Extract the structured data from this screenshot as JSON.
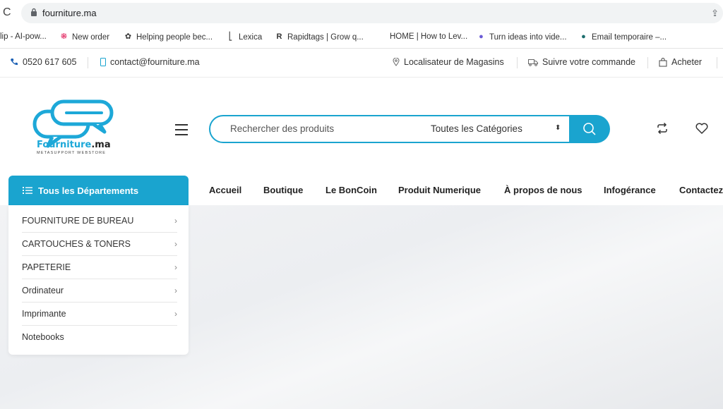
{
  "browser": {
    "url": "fourniture.ma",
    "bookmarks": [
      {
        "label": "lip - AI-pow...",
        "icon": ""
      },
      {
        "label": "New order",
        "icon": "slack-icon"
      },
      {
        "label": "Helping people bec...",
        "icon": "openai-icon"
      },
      {
        "label": "Lexica",
        "icon": "lexica-icon"
      },
      {
        "label": "Rapidtags | Grow q...",
        "icon": "rapidtags-icon"
      },
      {
        "label": "HOME | How to Lev...",
        "icon": ""
      },
      {
        "label": "Turn ideas into vide...",
        "icon": "video-icon"
      },
      {
        "label": "Email temporaire –...",
        "icon": "email-icon"
      }
    ]
  },
  "topbar": {
    "phone": "0520 617 605",
    "email": "contact@fourniture.ma",
    "store_locator": "Localisateur de Magasins",
    "track_order": "Suivre votre commande",
    "shop": "Acheter"
  },
  "header": {
    "logo_brand": "Fourniture",
    "logo_tld": ".ma",
    "logo_tagline": "METASUPPORT WEBSTORE",
    "search_placeholder": "Rechercher des produits",
    "category_selected": "Toutes les Catégories"
  },
  "departments": {
    "title": "Tous les Départements",
    "items": [
      {
        "label": "FOURNITURE DE BUREAU",
        "has_sub": true
      },
      {
        "label": "CARTOUCHES & TONERS",
        "has_sub": true
      },
      {
        "label": "PAPETERIE",
        "has_sub": true
      },
      {
        "label": "Ordinateur",
        "has_sub": true
      },
      {
        "label": "Imprimante",
        "has_sub": true
      },
      {
        "label": "Notebooks",
        "has_sub": false
      }
    ]
  },
  "nav": [
    "Accueil",
    "Boutique",
    "Le BonCoin",
    "Produit Numerique",
    "À propos de nous",
    "Infogérance",
    "Contactez"
  ],
  "colors": {
    "accent": "#1aa4cf"
  }
}
